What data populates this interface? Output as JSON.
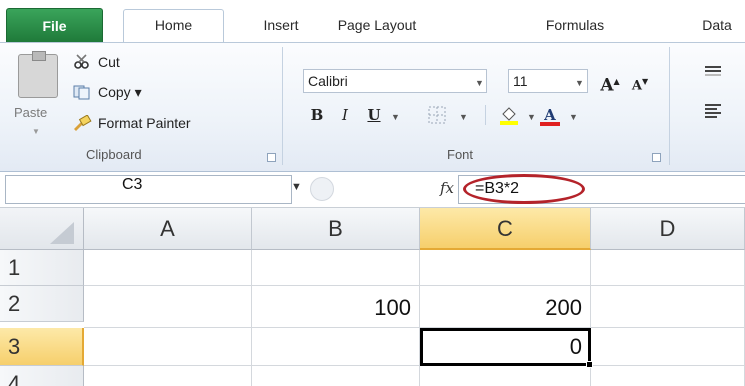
{
  "tabs": [
    {
      "label": "File"
    },
    {
      "label": "Home"
    },
    {
      "label": "Insert"
    },
    {
      "label": "Page Layout"
    },
    {
      "label": "Formulas"
    },
    {
      "label": "Data"
    }
  ],
  "ribbon": {
    "clipboard": {
      "paste_label": "Paste",
      "cut_label": "Cut",
      "copy_label": "Copy ▾",
      "format_painter_label": "Format Painter",
      "group_label": "Clipboard"
    },
    "font": {
      "font_name": "Calibri",
      "font_size": "11",
      "bold": "B",
      "italic": "I",
      "underline": "U",
      "grow_font": "A",
      "shrink_font": "A",
      "font_color_letter": "A",
      "group_label": "Font"
    }
  },
  "formula_bar": {
    "name_box": "C3",
    "fx_label": "fx",
    "formula": "=B3*2"
  },
  "grid": {
    "columns": [
      "A",
      "B",
      "C",
      "D"
    ],
    "selected_column": "C",
    "rows": [
      "1",
      "2",
      "3",
      "4"
    ],
    "selected_row": "3",
    "cells": {
      "B2": "100",
      "C2": "200",
      "C3": "0"
    },
    "active_cell": "C3"
  },
  "colors": {
    "file_tab": "#1f7a3a",
    "highlight_header": "#f6cf6c",
    "annotation_circle": "#b4232a",
    "font_color_bar": "#e02020",
    "highlight_color_bar": "#ffff00"
  }
}
